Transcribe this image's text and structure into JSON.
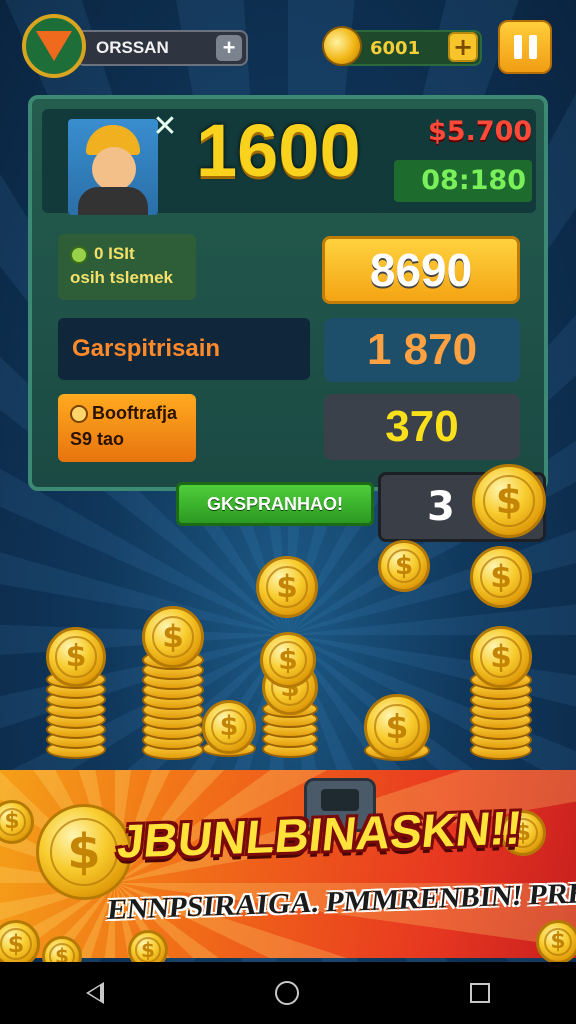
{
  "top_bar": {
    "player_name": "ORSSAN",
    "add_label": "+",
    "gold": "6001",
    "gold_add_label": "+"
  },
  "panel": {
    "close_label": "✕",
    "score": "1600",
    "price": "$5.700",
    "time": "08:180",
    "rows": [
      {
        "label_line1": "0 ISIt",
        "label_line2": "osih tslemek",
        "value": "8690"
      },
      {
        "label": "Garspitrisain",
        "value": "1 870"
      },
      {
        "label_line1": "Booftrafja",
        "label_line2": "S9 tao",
        "value": "370"
      }
    ],
    "action_button": "GKSPRANHAO!",
    "counter": "3"
  },
  "coin_symbol": "$",
  "banner": {
    "title": "JBUNLBINASKN!!",
    "subtitle": "ENNPSIRAIGA. PMMRENBIN! PREA"
  },
  "colors": {
    "gold": "#f8d21c",
    "price_red": "#ff4a3a",
    "time_green": "#79f05a",
    "panel_green": "#245c4e"
  }
}
